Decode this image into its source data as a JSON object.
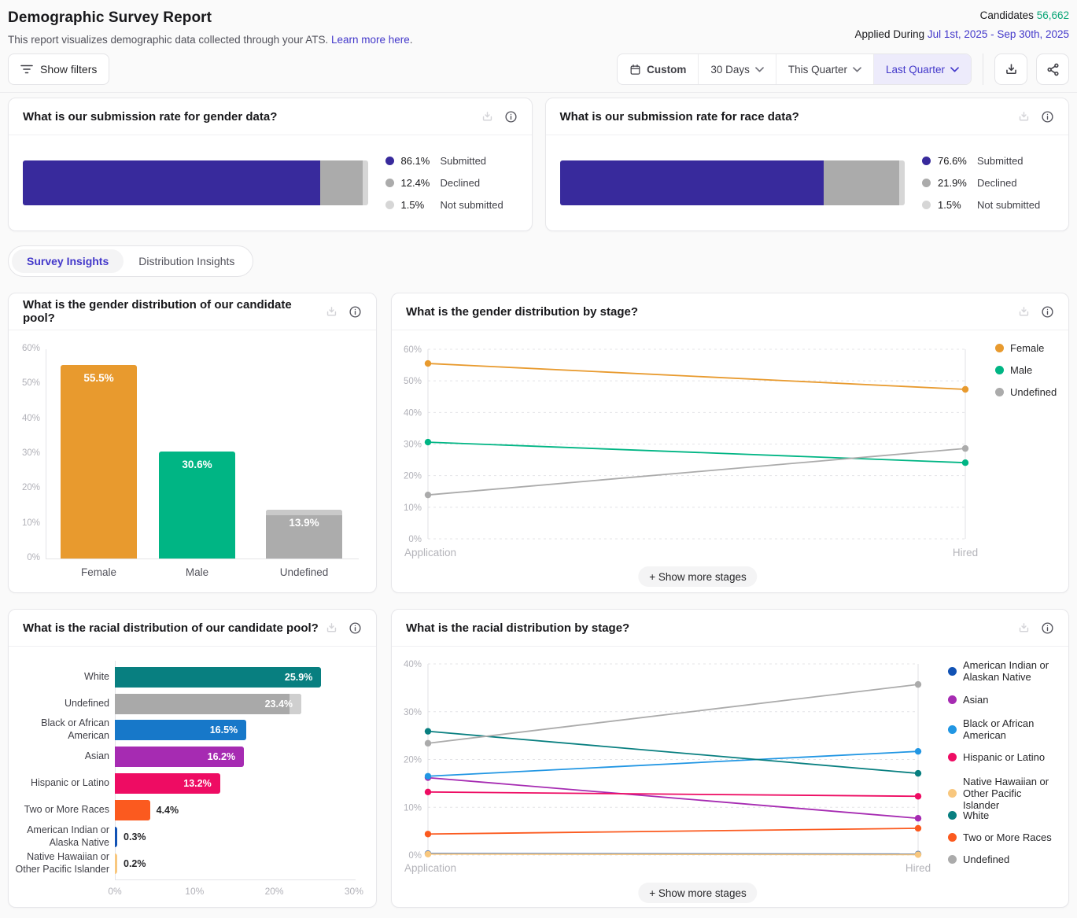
{
  "header": {
    "title": "Demographic Survey Report",
    "subtitle": "This report visualizes demographic data collected through your ATS.",
    "learn_more": "Learn more here",
    "suffix": ".",
    "candidates_label": "Candidates",
    "candidates_value": "56,662",
    "applied_label": "Applied During",
    "applied_value": "Jul 1st, 2025 - Sep 30th, 2025"
  },
  "toolbar": {
    "show_filters": "Show filters",
    "custom": "Custom",
    "ranges": [
      "30 Days",
      "This Quarter",
      "Last Quarter"
    ],
    "selected_range": "Last Quarter"
  },
  "tabs": [
    {
      "label": "Survey Insights",
      "active": true
    },
    {
      "label": "Distribution Insights",
      "active": false
    }
  ],
  "colors": {
    "accent": "#4338ca",
    "submitted": "#382a9c",
    "declined": "#ababab",
    "not_submitted": "#d6d6d6",
    "female": "#e89a2e",
    "male": "#00b584",
    "undefined_gray": "#acacac",
    "white_race": "#087f80",
    "black": "#1778c9",
    "asian": "#a62bb2",
    "hispanic": "#ee0c63",
    "two_or_more": "#fb5a1f",
    "american_indian": "#1152b4",
    "native_hawaiian": "#f8c77e"
  },
  "charts": {
    "gender_submission": {
      "type": "stacked-bar",
      "title": "What is our submission rate for gender data?",
      "segments": [
        {
          "label": "Submitted",
          "value": 86.1,
          "display": "86.1%",
          "color": "#382a9c"
        },
        {
          "label": "Declined",
          "value": 12.4,
          "display": "12.4%",
          "color": "#ababab"
        },
        {
          "label": "Not submitted",
          "value": 1.5,
          "display": "1.5%",
          "color": "#d6d6d6"
        }
      ]
    },
    "race_submission": {
      "type": "stacked-bar",
      "title": "What is our submission rate for race data?",
      "segments": [
        {
          "label": "Submitted",
          "value": 76.6,
          "display": "76.6%",
          "color": "#382a9c"
        },
        {
          "label": "Declined",
          "value": 21.9,
          "display": "21.9%",
          "color": "#ababab"
        },
        {
          "label": "Not submitted",
          "value": 1.5,
          "display": "1.5%",
          "color": "#d6d6d6"
        }
      ]
    },
    "gender_pool": {
      "type": "bar",
      "title": "What is the gender distribution of our candidate pool?",
      "ylim": [
        0,
        60
      ],
      "yticks": [
        "0%",
        "10%",
        "20%",
        "30%",
        "40%",
        "50%",
        "60%"
      ],
      "bars": [
        {
          "category": "Female",
          "value": 55.5,
          "display": "55.5%",
          "color": "#e89a2e"
        },
        {
          "category": "Male",
          "value": 30.6,
          "display": "30.6%",
          "color": "#00b584"
        },
        {
          "category": "Undefined",
          "value": 13.9,
          "display": "13.9%",
          "color": "#acacac",
          "cap_value": 1.5,
          "cap_color": "#c9c9c9"
        }
      ]
    },
    "gender_stage": {
      "type": "line",
      "title": "What is the gender distribution by stage?",
      "x_labels": [
        "Application",
        "Hired"
      ],
      "ylim": [
        0,
        60
      ],
      "yticks": [
        "0%",
        "10%",
        "20%",
        "30%",
        "40%",
        "50%",
        "60%"
      ],
      "series": [
        {
          "name": "Female",
          "color": "#e89a2e",
          "values": [
            55.5,
            47.3
          ]
        },
        {
          "name": "Male",
          "color": "#00b584",
          "values": [
            30.6,
            24.1
          ]
        },
        {
          "name": "Undefined",
          "color": "#ababab",
          "values": [
            13.9,
            28.6
          ]
        }
      ],
      "show_more_label": "+ Show more stages"
    },
    "race_pool": {
      "type": "bar-horizontal",
      "title": "What is the racial distribution of our candidate pool?",
      "xlim": [
        0,
        30
      ],
      "xticks": [
        "0%",
        "10%",
        "20%",
        "30%"
      ],
      "rows": [
        {
          "label": "White",
          "value": 25.9,
          "display": "25.9%",
          "color": "#087f80",
          "inside": true
        },
        {
          "label": "Undefined",
          "value": 23.4,
          "display": "23.4%",
          "color": "#a9a9a9",
          "inside": true,
          "cap_value": 1.5,
          "cap_color": "#cfcfcf"
        },
        {
          "label": "Black or African American",
          "value": 16.5,
          "display": "16.5%",
          "color": "#1778c9",
          "inside": true
        },
        {
          "label": "Asian",
          "value": 16.2,
          "display": "16.2%",
          "color": "#a62bb2",
          "inside": true
        },
        {
          "label": "Hispanic or Latino",
          "value": 13.2,
          "display": "13.2%",
          "color": "#ee0c63",
          "inside": true
        },
        {
          "label": "Two or More Races",
          "value": 4.4,
          "display": "4.4%",
          "color": "#fb5a1f",
          "inside": false
        },
        {
          "label": "American Indian or Alaska Native",
          "value": 0.3,
          "display": "0.3%",
          "color": "#1152b4",
          "inside": false
        },
        {
          "label": "Native Hawaiian or Other Pacific Islander",
          "value": 0.2,
          "display": "0.2%",
          "color": "#f8c77e",
          "inside": false
        }
      ]
    },
    "race_stage": {
      "type": "line",
      "title": "What is the racial distribution by stage?",
      "x_labels": [
        "Application",
        "Hired"
      ],
      "ylim": [
        0,
        40
      ],
      "yticks": [
        "0%",
        "10%",
        "20%",
        "30%",
        "40%"
      ],
      "series": [
        {
          "name": "American Indian or Alaskan Native",
          "color": "#1152b4",
          "values": [
            0.3,
            0.2
          ],
          "two_line": true
        },
        {
          "name": "Asian",
          "color": "#a62bb2",
          "values": [
            16.2,
            7.7
          ],
          "two_line": false
        },
        {
          "name": "Black or African American",
          "color": "#2196e3",
          "values": [
            16.5,
            21.7
          ],
          "two_line": true
        },
        {
          "name": "Hispanic or Latino",
          "color": "#ee0c63",
          "values": [
            13.2,
            12.3
          ],
          "two_line": false
        },
        {
          "name": "Native Hawaiian or Other Pacific Islander",
          "color": "#f8c77e",
          "values": [
            0.2,
            0.1
          ],
          "two_line": true
        },
        {
          "name": "White",
          "color": "#087f80",
          "values": [
            25.9,
            17.1
          ],
          "two_line": false
        },
        {
          "name": "Two or More Races",
          "color": "#fb5a1f",
          "values": [
            4.4,
            5.6
          ],
          "two_line": false
        },
        {
          "name": "Undefined",
          "color": "#ababab",
          "values": [
            23.4,
            35.7
          ],
          "two_line": false
        }
      ],
      "show_more_label": "+ Show more stages"
    }
  }
}
